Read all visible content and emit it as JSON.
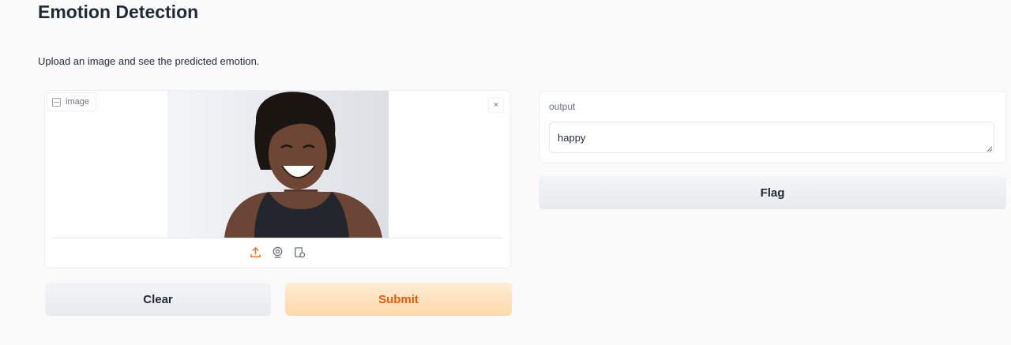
{
  "header": {
    "title": "Emotion Detection",
    "description": "Upload an image and see the predicted emotion."
  },
  "image_input": {
    "label": "image",
    "label_icon": "image-icon",
    "close_icon": "close-icon",
    "close_glyph": "×",
    "photo_subject": "smiling woman",
    "sources": [
      {
        "name": "upload-icon",
        "color": "#f97316"
      },
      {
        "name": "webcam-icon",
        "color": "#6b7280"
      },
      {
        "name": "clipboard-icon",
        "color": "#6b7280"
      }
    ]
  },
  "buttons": {
    "clear_label": "Clear",
    "submit_label": "Submit",
    "flag_label": "Flag"
  },
  "output": {
    "label": "output",
    "value": "happy"
  },
  "colors": {
    "accent": "#ea580c",
    "submit_bg": "#fdd9a8",
    "secondary_bg": "#e8eaed",
    "page_bg": "#fafafa"
  }
}
